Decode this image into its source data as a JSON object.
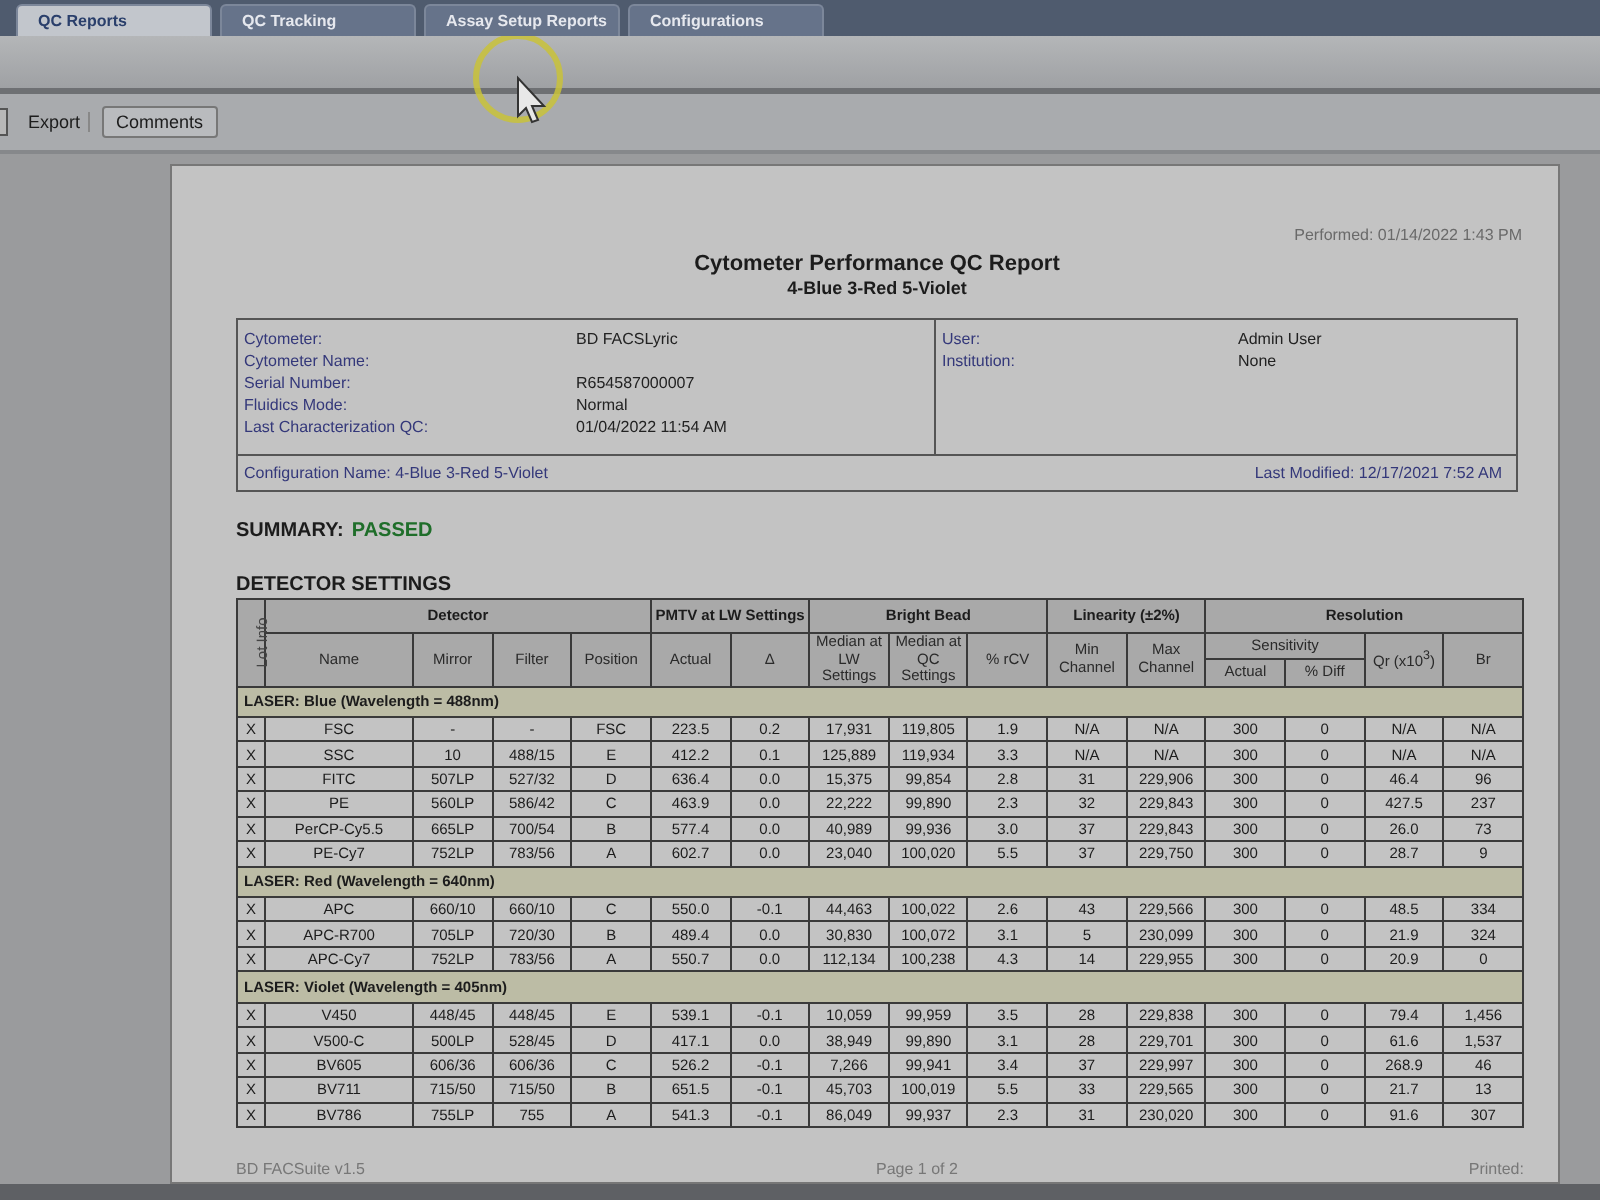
{
  "tabs": [
    {
      "label": "QC Reports",
      "selected": true
    },
    {
      "label": "QC Tracking",
      "selected": false
    },
    {
      "label": "Assay Setup Reports",
      "selected": false
    },
    {
      "label": "Configurations",
      "selected": false
    }
  ],
  "toolbar": [
    {
      "kind": "stub"
    },
    {
      "kind": "text",
      "label": "Export"
    },
    {
      "kind": "button",
      "label": "Comments"
    }
  ],
  "report": {
    "performed": "Performed: 01/14/2022 1:43 PM",
    "title": "Cytometer Performance QC Report",
    "subtitle": "4-Blue 3-Red 5-Violet",
    "info_left": [
      {
        "label": "Cytometer:",
        "value": "BD FACSLyric"
      },
      {
        "label": "Cytometer Name:"
      },
      {
        "label": "Serial Number:",
        "value": "R654587000007"
      },
      {
        "label": "Fluidics Mode:",
        "value": "Normal"
      },
      {
        "label": "Last Characterization QC:",
        "value": "01/04/2022 11:54 AM"
      }
    ],
    "info_right": [
      {
        "label": "User:",
        "value": "Admin User"
      },
      {
        "label": "Institution:",
        "value": "None"
      }
    ],
    "configuration": "Configuration Name: 4-Blue 3-Red 5-Violet",
    "last_modified": "Last Modified: 12/17/2021 7:52 AM",
    "summary": {
      "label": "SUMMARY:",
      "result": "PASSED",
      "passed": true
    },
    "section_title": "DETECTOR SETTINGS",
    "table": {
      "lot_info": "Lot Info",
      "groups": [
        "Detector",
        "PMTV at LW Settings",
        "Bright Bead",
        "Linearity (±2%)",
        "Resolution"
      ],
      "columns": [
        "Name",
        "Mirror",
        "Filter",
        "Position",
        "Actual",
        "Δ",
        "Median at LW Settings",
        "Median at QC Settings",
        "% rCV",
        "Min Channel",
        "Max Channel"
      ],
      "sensitivity": "Sensitivity",
      "sensitivity_columns": [
        "Actual",
        "% Diff"
      ],
      "tail_columns": [
        "Qr (x10$^{3}$)",
        "Br"
      ],
      "lasers": [
        {
          "title": "LASER: Blue (Wavelength = 488nm)",
          "rows": [
            [
              "X",
              "FSC",
              "-",
              "-",
              "FSC",
              "223.5",
              "0.2",
              "17,931",
              "119,805",
              "1.9",
              "N/A",
              "N/A",
              "300",
              "0",
              "N/A",
              "N/A"
            ],
            [
              "X",
              "SSC",
              "10",
              "488/15",
              "E",
              "412.2",
              "0.1",
              "125,889",
              "119,934",
              "3.3",
              "N/A",
              "N/A",
              "300",
              "0",
              "N/A",
              "N/A"
            ],
            [
              "X",
              "FITC",
              "507LP",
              "527/32",
              "D",
              "636.4",
              "0.0",
              "15,375",
              "99,854",
              "2.8",
              "31",
              "229,906",
              "300",
              "0",
              "46.4",
              "96"
            ],
            [
              "X",
              "PE",
              "560LP",
              "586/42",
              "C",
              "463.9",
              "0.0",
              "22,222",
              "99,890",
              "2.3",
              "32",
              "229,843",
              "300",
              "0",
              "427.5",
              "237"
            ],
            [
              "X",
              "PerCP-Cy5.5",
              "665LP",
              "700/54",
              "B",
              "577.4",
              "0.0",
              "40,989",
              "99,936",
              "3.0",
              "37",
              "229,843",
              "300",
              "0",
              "26.0",
              "73"
            ],
            [
              "X",
              "PE-Cy7",
              "752LP",
              "783/56",
              "A",
              "602.7",
              "0.0",
              "23,040",
              "100,020",
              "5.5",
              "37",
              "229,750",
              "300",
              "0",
              "28.7",
              "9"
            ]
          ]
        },
        {
          "title": "LASER: Red (Wavelength = 640nm)",
          "rows": [
            [
              "X",
              "APC",
              "660/10",
              "660/10",
              "C",
              "550.0",
              "-0.1",
              "44,463",
              "100,022",
              "2.6",
              "43",
              "229,566",
              "300",
              "0",
              "48.5",
              "334"
            ],
            [
              "X",
              "APC-R700",
              "705LP",
              "720/30",
              "B",
              "489.4",
              "0.0",
              "30,830",
              "100,072",
              "3.1",
              "5",
              "230,099",
              "300",
              "0",
              "21.9",
              "324"
            ],
            [
              "X",
              "APC-Cy7",
              "752LP",
              "783/56",
              "A",
              "550.7",
              "0.0",
              "112,134",
              "100,238",
              "4.3",
              "14",
              "229,955",
              "300",
              "0",
              "20.9",
              "0"
            ]
          ]
        },
        {
          "title": "LASER: Violet (Wavelength = 405nm)",
          "rows": [
            [
              "X",
              "V450",
              "448/45",
              "448/45",
              "E",
              "539.1",
              "-0.1",
              "10,059",
              "99,959",
              "3.5",
              "28",
              "229,838",
              "300",
              "0",
              "79.4",
              "1,456"
            ],
            [
              "X",
              "V500-C",
              "500LP",
              "528/45",
              "D",
              "417.1",
              "0.0",
              "38,949",
              "99,890",
              "3.1",
              "28",
              "229,701",
              "300",
              "0",
              "61.6",
              "1,537"
            ],
            [
              "X",
              "BV605",
              "606/36",
              "606/36",
              "C",
              "526.2",
              "-0.1",
              "7,266",
              "99,941",
              "3.4",
              "37",
              "229,997",
              "300",
              "0",
              "268.9",
              "46"
            ],
            [
              "X",
              "BV711",
              "715/50",
              "715/50",
              "B",
              "651.5",
              "-0.1",
              "45,703",
              "100,019",
              "5.5",
              "33",
              "229,565",
              "300",
              "0",
              "21.7",
              "13"
            ],
            [
              "X",
              "BV786",
              "755LP",
              "755",
              "A",
              "541.3",
              "-0.1",
              "86,049",
              "99,937",
              "2.3",
              "31",
              "230,020",
              "300",
              "0",
              "91.6",
              "307"
            ]
          ]
        }
      ]
    },
    "footer": {
      "left": "BD FACSuite v1.5",
      "center": "Page 1 of 2",
      "right": "Printed:"
    }
  }
}
